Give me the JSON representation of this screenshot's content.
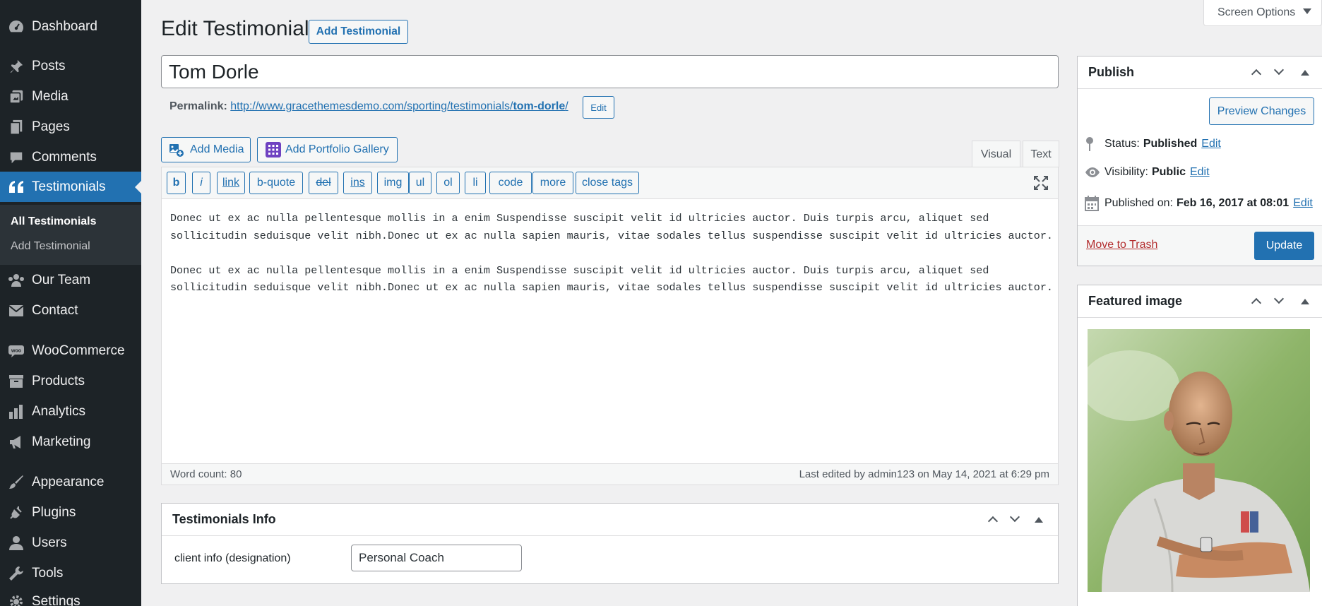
{
  "sidebar": {
    "items": [
      {
        "label": "Dashboard",
        "icon": "dashboard-icon"
      },
      {
        "label": "Posts",
        "icon": "pin-icon"
      },
      {
        "label": "Media",
        "icon": "media-icon"
      },
      {
        "label": "Pages",
        "icon": "pages-icon"
      },
      {
        "label": "Comments",
        "icon": "comment-icon"
      },
      {
        "label": "Testimonials",
        "icon": "quote-icon"
      },
      {
        "label": "Our Team",
        "icon": "team-icon"
      },
      {
        "label": "Contact",
        "icon": "mail-icon"
      },
      {
        "label": "WooCommerce",
        "icon": "woo-icon"
      },
      {
        "label": "Products",
        "icon": "archive-icon"
      },
      {
        "label": "Analytics",
        "icon": "bar-chart-icon"
      },
      {
        "label": "Marketing",
        "icon": "megaphone-icon"
      },
      {
        "label": "Appearance",
        "icon": "brush-icon"
      },
      {
        "label": "Plugins",
        "icon": "plugin-icon"
      },
      {
        "label": "Users",
        "icon": "users-icon"
      },
      {
        "label": "Tools",
        "icon": "wrench-icon"
      },
      {
        "label": "Settings",
        "icon": "settings-icon"
      }
    ],
    "submenu": {
      "all": "All Testimonials",
      "add": "Add Testimonial"
    }
  },
  "header": {
    "screen_options": "Screen Options",
    "title": "Edit Testimonial",
    "add_button": "Add Testimonial"
  },
  "post": {
    "title": "Tom Dorle",
    "permalink_label": "Permalink:",
    "permalink_base": "http://www.gracethemesdemo.com/sporting/testimonials/",
    "permalink_slug": "tom-dorle",
    "permalink_tail": "/",
    "permalink_edit": "Edit"
  },
  "editor": {
    "add_media": "Add Media",
    "add_gallery": "Add Portfolio Gallery",
    "tab_visual": "Visual",
    "tab_text": "Text",
    "quicktags": [
      "b",
      "i",
      "link",
      "b-quote",
      "del",
      "ins",
      "img",
      "ul",
      "ol",
      "li",
      "code",
      "more",
      "close tags"
    ],
    "content": "Donec ut ex ac nulla pellentesque mollis in a enim Suspendisse suscipit velit id ultricies auctor. Duis turpis arcu, aliquet sed\nsollicitudin seduisque velit nibh.Donec ut ex ac nulla sapien mauris, vitae sodales tellus suspendisse suscipit velit id ultricies auctor.\n\nDonec ut ex ac nulla pellentesque mollis in a enim Suspendisse suscipit velit id ultricies auctor. Duis turpis arcu, aliquet sed\nsollicitudin seduisque velit nibh.Donec ut ex ac nulla sapien mauris, vitae sodales tellus suspendisse suscipit velit id ultricies auctor.",
    "word_count": "Word count: 80",
    "last_edited": "Last edited by admin123 on May 14, 2021 at 6:29 pm"
  },
  "testimonials_info": {
    "title": "Testimonials Info",
    "field_label": "client info (designation)",
    "field_value": "Personal Coach"
  },
  "publish": {
    "title": "Publish",
    "preview": "Preview Changes",
    "status_label": "Status:",
    "status_value": "Published",
    "visibility_label": "Visibility:",
    "visibility_value": "Public",
    "published_label": "Published on:",
    "published_value": "Feb 16, 2017 at 08:01",
    "edit": "Edit",
    "trash": "Move to Trash",
    "update": "Update"
  },
  "featured": {
    "title": "Featured image"
  },
  "colors": {
    "accent": "#2271b1",
    "sidebar": "#1d2327",
    "trash": "#b32d2e"
  }
}
